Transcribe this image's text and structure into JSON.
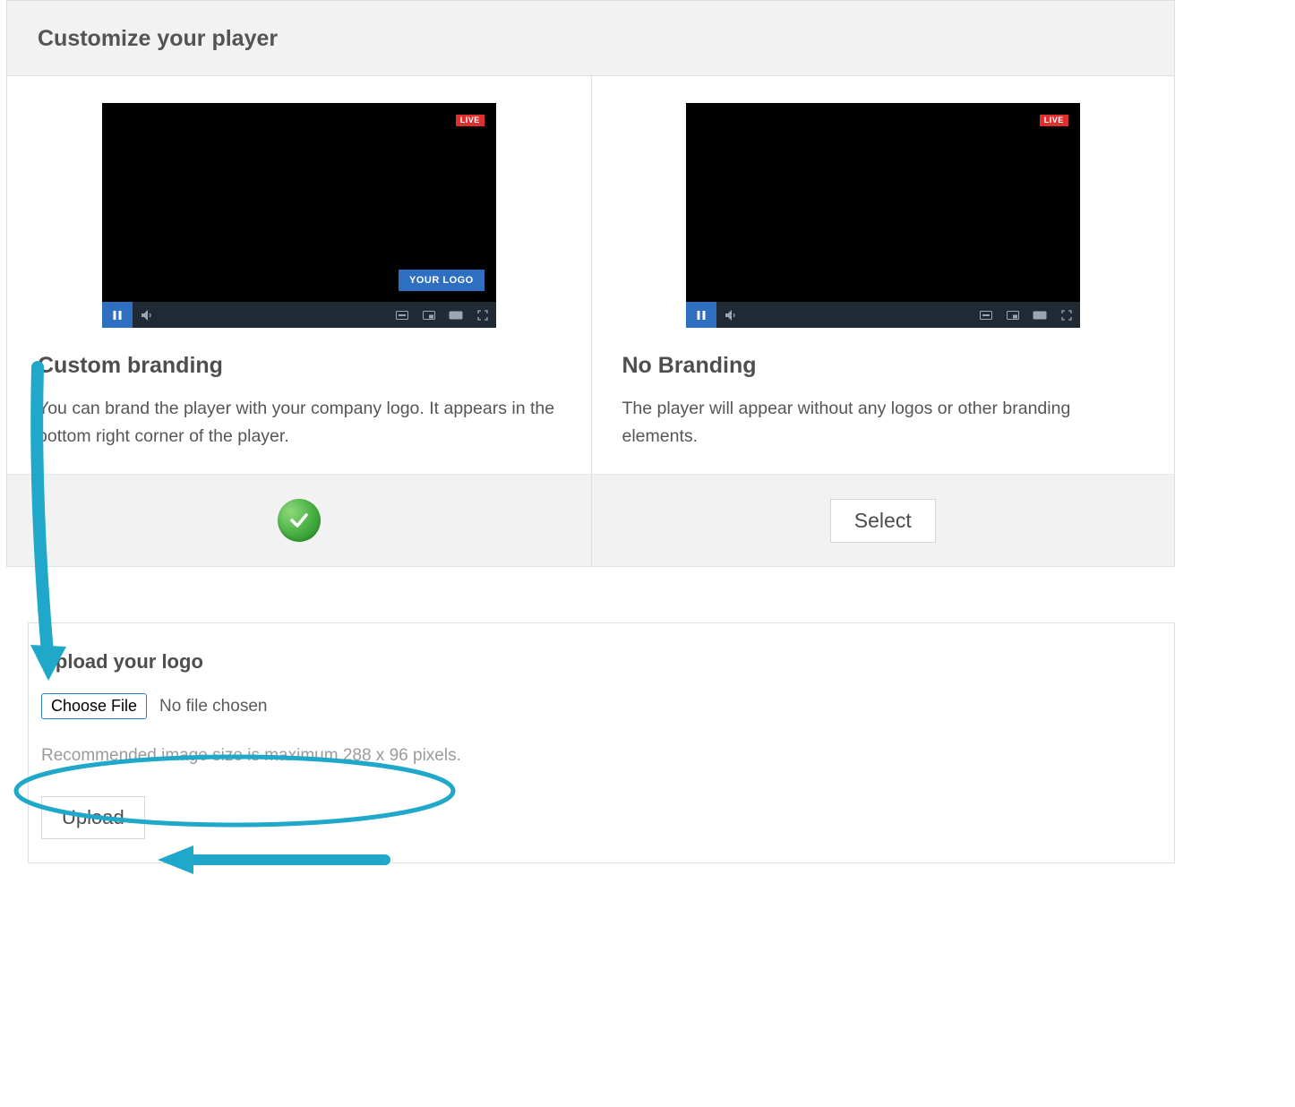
{
  "header": {
    "title": "Customize your player"
  },
  "player_ui": {
    "live_badge": "LIVE",
    "logo_chip": "YOUR LOGO"
  },
  "options": {
    "custom": {
      "title": "Custom branding",
      "desc": "You can brand the player with your company logo. It appears in the bottom right corner of the player.",
      "selected": true
    },
    "none": {
      "title": "No Branding",
      "desc": "The player will appear without any logos or other branding elements.",
      "select_label": "Select"
    }
  },
  "upload": {
    "title": "Upload your logo",
    "choose_label": "Choose File",
    "no_file": "No file chosen",
    "hint": "Recommended image size is maximum 288 x 96 pixels.",
    "button": "Upload"
  },
  "colors": {
    "brand_blue": "#2f6fc1",
    "annotation": "#1fa8c9",
    "live_red": "#e02f2f",
    "check_green": "#3fa93c"
  }
}
